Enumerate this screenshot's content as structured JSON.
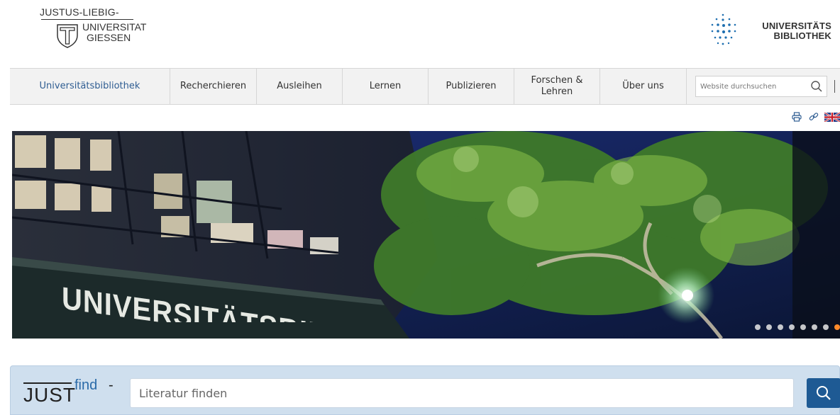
{
  "header": {
    "jlu_logo": {
      "line1": "JUSTUS-LIEBIG-",
      "line2": "UNIVERSITAT",
      "line3": "GIESSEN"
    },
    "ub_logo": {
      "line1": "UNIVERSITÄTS",
      "line2": "BIBLIOTHEK",
      "dot_color": "#1f6fb0"
    }
  },
  "nav": {
    "items": [
      {
        "label": "Universitätsbibliothek",
        "active": true
      },
      {
        "label": "Recherchieren"
      },
      {
        "label": "Ausleihen"
      },
      {
        "label": "Lernen"
      },
      {
        "label": "Publizieren"
      },
      {
        "label": "Forschen & Lehren"
      },
      {
        "label": "Über uns"
      }
    ],
    "search": {
      "placeholder": "Website durchsuchen",
      "icon": "search-icon"
    }
  },
  "utilities": [
    {
      "icon": "print-icon"
    },
    {
      "icon": "link-icon"
    },
    {
      "icon": "uk-flag-icon"
    }
  ],
  "hero": {
    "building_sign": "UNIVERSITÄTSBIBLIOTHEK",
    "slides": 8,
    "active_slide": 8,
    "accent": "#ff8a2a"
  },
  "justfind": {
    "logo_just": "JUST",
    "logo_find": "find",
    "logo_dash": "-",
    "placeholder": "Literatur finden",
    "button_icon": "search-icon",
    "bar_color": "#cfdfee",
    "button_color": "#1e5a94"
  }
}
